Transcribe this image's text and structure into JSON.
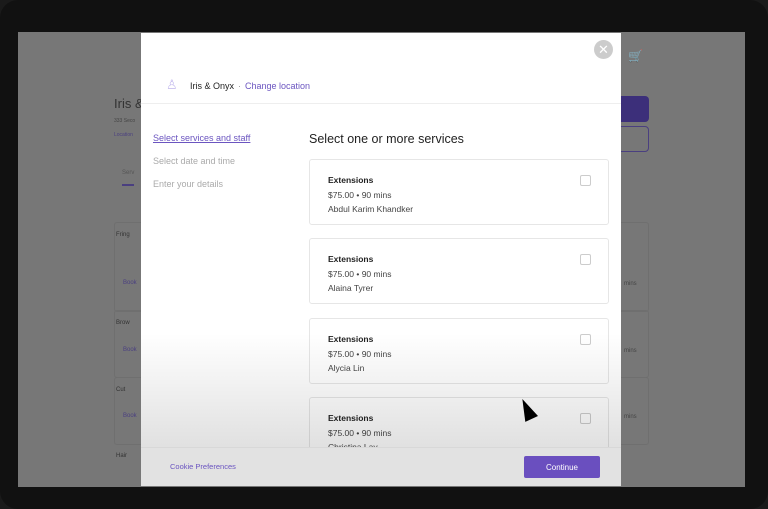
{
  "background_page": {
    "title": "Iris &",
    "address": "333 Seco",
    "link": "Location",
    "tab": "Serv",
    "items": [
      {
        "label": "Fring",
        "book": "Book",
        "mins": "mins"
      },
      {
        "label": "Brow",
        "book": "Book",
        "mins": "mins"
      },
      {
        "label": "Cut",
        "book": "Book",
        "mins": "mins"
      },
      {
        "label": "Hair",
        "book": "Book",
        "mins": "mins"
      }
    ]
  },
  "modal": {
    "business_name": "Iris & Onyx",
    "separator": "·",
    "change_location": "Change location",
    "steps": [
      {
        "label": "Select services and staff",
        "active": true
      },
      {
        "label": "Select date and time",
        "active": false
      },
      {
        "label": "Enter your details",
        "active": false
      }
    ],
    "heading": "Select one or more services",
    "services": [
      {
        "name": "Extensions",
        "price": "$75.00",
        "duration": "90 mins",
        "staff": "Abdul Karim Khandker",
        "checked": false
      },
      {
        "name": "Extensions",
        "price": "$75.00",
        "duration": "90 mins",
        "staff": "Alaina Tyrer",
        "checked": false
      },
      {
        "name": "Extensions",
        "price": "$75.00",
        "duration": "90 mins",
        "staff": "Alycia Lin",
        "checked": false
      },
      {
        "name": "Extensions",
        "price": "$75.00",
        "duration": "90 mins",
        "staff": "Christina Lay",
        "checked": false
      }
    ],
    "footer": {
      "cookie": "Cookie Preferences",
      "continue": "Continue"
    }
  },
  "colors": {
    "accent": "#6a4fbf",
    "link": "#6b55c0"
  }
}
